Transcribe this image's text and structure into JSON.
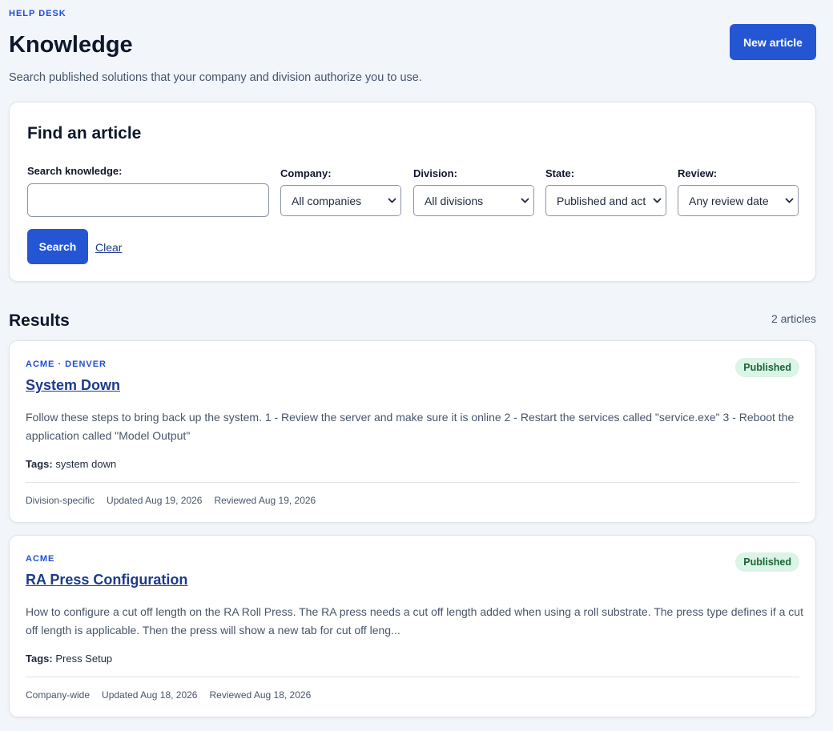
{
  "header": {
    "eyebrow": "HELP DESK",
    "title": "Knowledge",
    "subtitle": "Search published solutions that your company and division authorize you to use.",
    "new_button": "New article"
  },
  "find": {
    "title": "Find an article",
    "search_label": "Search knowledge:",
    "search_value": "",
    "company_label": "Company:",
    "company_value": "All companies",
    "division_label": "Division:",
    "division_value": "All divisions",
    "state_label": "State:",
    "state_value": "Published and act",
    "review_label": "Review:",
    "review_value": "Any review date",
    "search_button": "Search",
    "clear_link": "Clear"
  },
  "results": {
    "title": "Results",
    "count": "2 articles",
    "items": [
      {
        "org": "ACME · DENVER",
        "title": "System Down",
        "status": "Published",
        "summary": "Follow these steps to bring back up the system. 1 - Review the server and make sure it is online 2 - Restart the services called \"service.exe\" 3 - Reboot the application called \"Model Output\"",
        "tags_label": "Tags:",
        "tags": "system down",
        "scope": "Division-specific",
        "updated": "Updated Aug 19, 2026",
        "reviewed": "Reviewed Aug 19, 2026"
      },
      {
        "org": "ACME",
        "title": "RA Press Configuration",
        "status": "Published",
        "summary": "How to configure a cut off length on the RA Roll Press. The RA press needs a cut off length added when using a roll substrate. The press type defines if a cut off length is applicable. Then the press will show a new tab for cut off leng...",
        "tags_label": "Tags:",
        "tags": "Press Setup",
        "scope": "Company-wide",
        "updated": "Updated Aug 18, 2026",
        "reviewed": "Reviewed Aug 18, 2026"
      }
    ]
  },
  "colors": {
    "accent": "#2456d3",
    "link": "#1e3a8a",
    "badge_bg": "#dcf3e8",
    "badge_text": "#166534",
    "page_bg": "#f2f5fa"
  },
  "icons": {
    "select_chevron": "chevron-down-icon"
  }
}
